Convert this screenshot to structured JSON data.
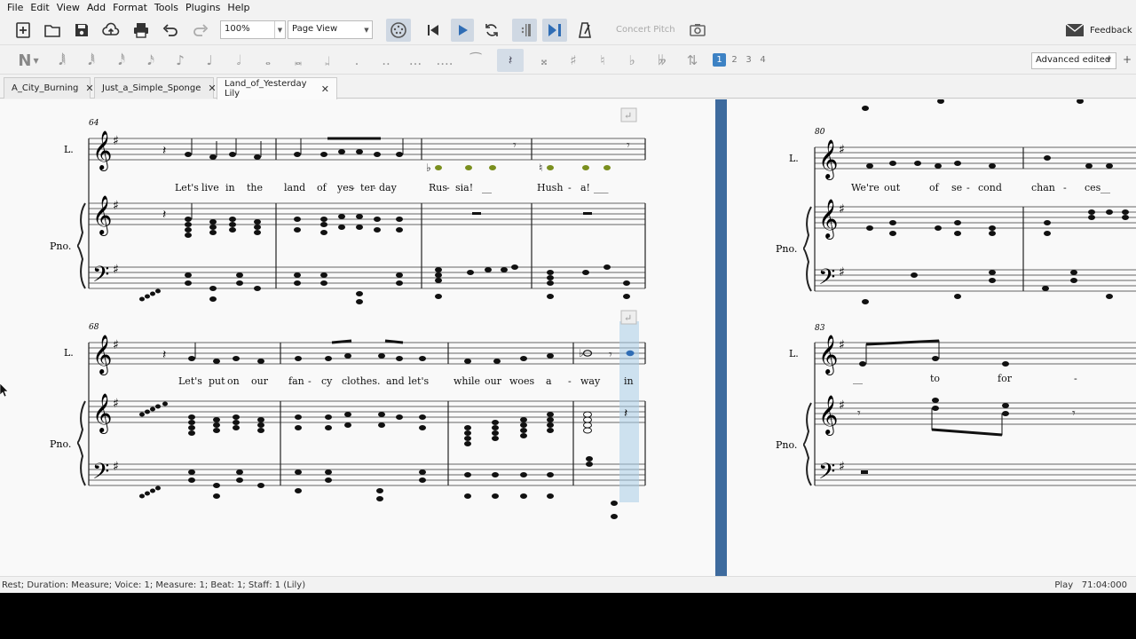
{
  "menu": [
    "File",
    "Edit",
    "View",
    "Add",
    "Format",
    "Tools",
    "Plugins",
    "Help"
  ],
  "toolbar": {
    "zoom_value": "100%",
    "view_mode": "Page View",
    "concert_pitch": "Concert Pitch",
    "feedback": "Feedback"
  },
  "note_input": {
    "voices": [
      "1",
      "2",
      "3",
      "4"
    ],
    "workspace": "Advanced edited",
    "add_workspace": "+"
  },
  "tabs": [
    {
      "label": "A_City_Burning",
      "close": "✕"
    },
    {
      "label": "Just_a_Simple_Sponge",
      "close": "✕"
    },
    {
      "label": "Land_of_Yesterday Lily",
      "close": "✕"
    }
  ],
  "score": {
    "instrument_voice": "L.",
    "instrument_piano": "Pno.",
    "systems": [
      {
        "measure_number": "64",
        "lyrics": [
          "Let's",
          "live",
          "in",
          "the",
          "land",
          "of",
          "yes",
          "-",
          "ter",
          "-",
          "day",
          "Rus",
          "-",
          "sia!",
          "__",
          "Hush",
          "-",
          "a!",
          "___"
        ]
      },
      {
        "measure_number": "68",
        "lyrics": [
          "Let's",
          "put",
          "on",
          "our",
          "fan",
          "-",
          "cy",
          "clothes.",
          "and",
          "let's",
          "while",
          "our",
          "woes",
          "a",
          "-",
          "way",
          "in"
        ]
      },
      {
        "measure_number": "80",
        "lyrics": [
          "We're",
          "out",
          "of",
          "se",
          "-",
          "cond",
          "chan",
          "-",
          "ces",
          "__"
        ]
      },
      {
        "measure_number": "83",
        "lyrics": [
          "__",
          "to",
          "for",
          "-"
        ]
      }
    ]
  },
  "status": {
    "left": "Rest; Duration: Measure; Voice: 1;  Measure: 1; Beat: 1; Staff: 1 (Lily)",
    "mode": "Play",
    "time": "71:04:000"
  }
}
